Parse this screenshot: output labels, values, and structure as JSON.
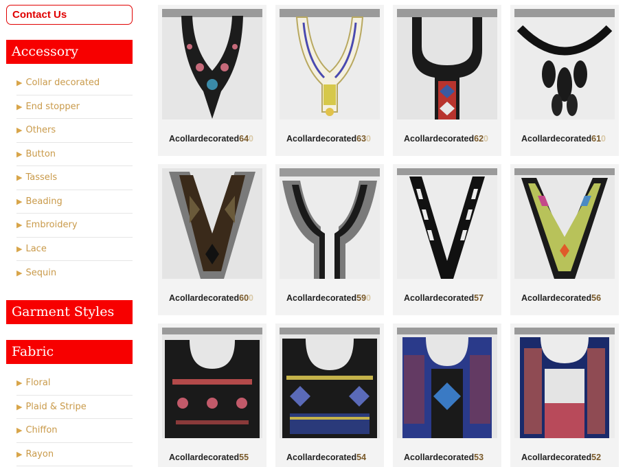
{
  "contact": {
    "label": "Contact Us"
  },
  "accessory": {
    "title": "Accessory",
    "items": [
      "Collar decorated",
      "End stopper",
      "Others",
      "Button",
      "Tassels",
      "Beading",
      "Embroidery",
      "Lace",
      "Sequin"
    ]
  },
  "garment": {
    "title": "Garment Styles"
  },
  "fabric": {
    "title": "Fabric",
    "items": [
      "Floral",
      "Plaid & Stripe",
      "Chiffon",
      "Rayon"
    ]
  },
  "products": [
    {
      "name": "Acollardecorated",
      "num": "64",
      "ghost": "0"
    },
    {
      "name": "Acollardecorated",
      "num": "63",
      "ghost": "0"
    },
    {
      "name": "Acollardecorated",
      "num": "62",
      "ghost": "0"
    },
    {
      "name": "Acollardecorated",
      "num": "61",
      "ghost": "0"
    },
    {
      "name": "Acollardecorated",
      "num": "60",
      "ghost": "0"
    },
    {
      "name": "Acollardecorated",
      "num": "59",
      "ghost": "0"
    },
    {
      "name": "Acollardecorated",
      "num": "57",
      "ghost": ""
    },
    {
      "name": "Acollardecorated",
      "num": "56",
      "ghost": ""
    },
    {
      "name": "Acollardecorated",
      "num": "55",
      "ghost": ""
    },
    {
      "name": "Acollardecorated",
      "num": "54",
      "ghost": ""
    },
    {
      "name": "Acollardecorated",
      "num": "53",
      "ghost": ""
    },
    {
      "name": "Acollardecorated",
      "num": "52",
      "ghost": ""
    }
  ],
  "icons": {
    "bullet": "triangle-right-icon"
  },
  "colors": {
    "brand_red": "#f70000",
    "link_gold": "#c99a4a"
  }
}
